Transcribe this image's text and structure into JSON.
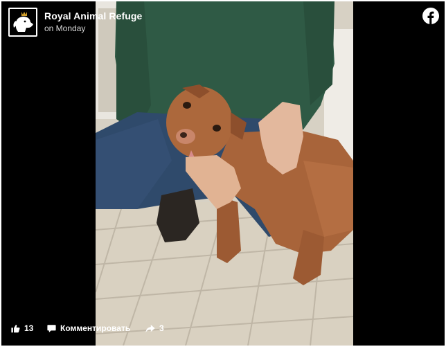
{
  "post": {
    "page_name": "Royal Animal Refuge",
    "time": "on Monday"
  },
  "photo": {
    "icon": "dog-photo"
  },
  "footer": {
    "like_count": "13",
    "comment_label": "Комментировать",
    "share_count": "3"
  },
  "icons": {
    "brand": "facebook-icon",
    "like": "thumbs-up-icon",
    "comment": "comment-bubble-icon",
    "share": "share-arrow-icon"
  },
  "colors": {
    "background": "#000000",
    "text": "#ffffff",
    "subtext": "#d8d8d8"
  }
}
